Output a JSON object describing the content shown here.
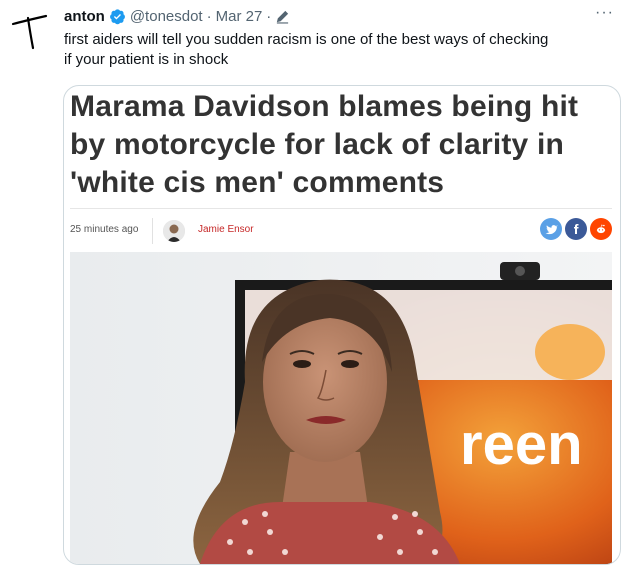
{
  "tweet": {
    "display_name": "anton",
    "handle": "@tonesdot",
    "separator": "·",
    "date": "Mar 27",
    "separator2": "·",
    "text_line1": "first aiders will tell you sudden racism is one of the best ways of checking",
    "text_line2": "if your patient is in shock",
    "more_label": "···"
  },
  "card": {
    "headline_line1": "Marama Davidson blames being hit",
    "headline_line2": "by motorcycle for lack of clarity in",
    "headline_line3": "'white cis men' comments",
    "time_ago": "25 minutes ago",
    "author": "Jamie Ensor",
    "share_icons": [
      "twitter-share-icon",
      "facebook-share-icon",
      "reddit-share-icon"
    ],
    "share_colors": [
      "#5aa0e6",
      "#3b5998",
      "#ff4500"
    ],
    "background_sign_text": "reen"
  }
}
